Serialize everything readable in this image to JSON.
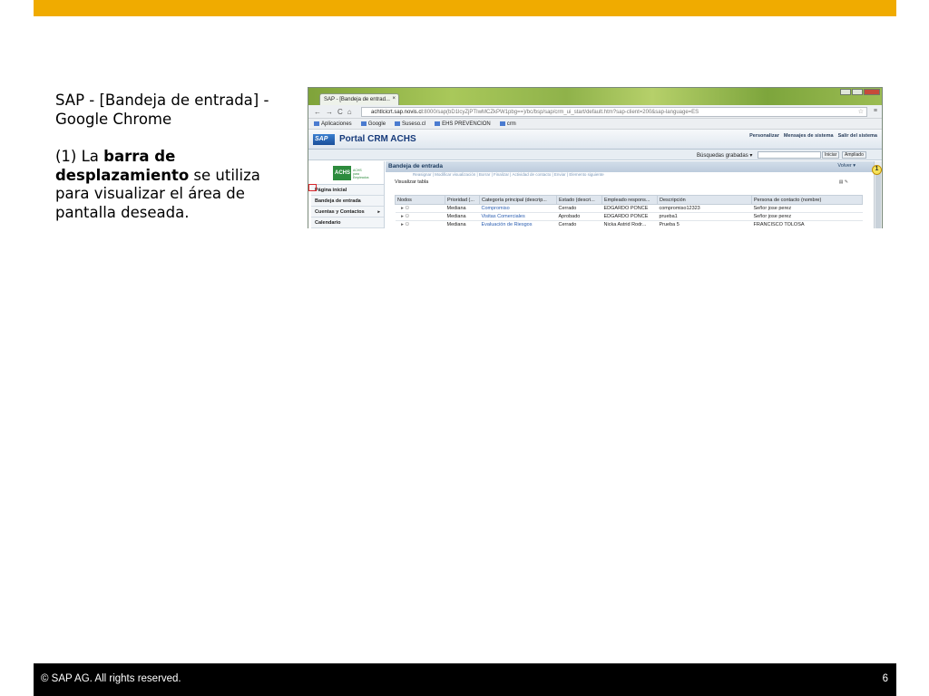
{
  "slide": {
    "title": "SAP - [Bandeja de entrada] - Google Chrome",
    "para_prefix": "(1) La ",
    "para_bold": "barra de desplazamiento",
    "para_suffix": " se utiliza para visualizar el área de pantalla deseada.",
    "footer_copyright": "©  SAP AG. All rights reserved.",
    "page_number": "6",
    "colors": {
      "accent_bar": "#f0ab00",
      "footer_bg": "#000000"
    }
  },
  "browser": {
    "tab_title": "SAP - [Bandeja de entrad...",
    "tab_close": "×",
    "url_host": "achtlcicrt.sap.novis.cl",
    "url_path": ":8000/sap(bD1lcyZjPTIwMCZkPW1pbg==)/bc/bsp/sap/crm_ui_start/default.htm?sap-client=200&sap-language=ES",
    "bookmarks": [
      "Aplicaciones",
      "Google",
      "Suseso.cl",
      "EHS PREVENCION",
      "crm"
    ]
  },
  "portal": {
    "logo_text": "SAP",
    "title": "Portal CRM ACHS",
    "header_links": [
      "Personalizar",
      "Mensajes de sistema",
      "Salir del sistema"
    ],
    "saved_searches": "Búsquedas grabadas ▾",
    "search_button": "Iniciar",
    "advanced_button": "Ampliado"
  },
  "sidebar": {
    "logo": "ACHS",
    "logo_sub": "ACHS para Empleados",
    "items": [
      {
        "label": "Página inicial",
        "arrow": ""
      },
      {
        "label": "Bandeja de entrada",
        "arrow": ""
      },
      {
        "label": "Cuentas y Contactos",
        "arrow": "►"
      },
      {
        "label": "Calendario",
        "arrow": ""
      }
    ]
  },
  "inbox": {
    "header": "Bandeja de entrada",
    "back": "Volver ▾",
    "cut_links": "Reasignar  |  Modificar visualización  |  Borrar  |  Finalizar  |  Actividad de contacto  |  Enviar  |  Elemento siguiente",
    "table_action": "Visualizar tabla",
    "columns": [
      "Nodos",
      "Prioridad (...",
      "Categoría principal (descrip...",
      "Estado (descri...",
      "Empleado respons...",
      "Descripción",
      "Persona de contacto (nombre)"
    ],
    "rows": [
      [
        "Mediana",
        "Compromiso",
        "Cerrado",
        "EDGARDO PONCE",
        "compromiso12323",
        "Señor jose perez"
      ],
      [
        "Mediana",
        "Visitas Comerciales",
        "Aprobado",
        "EDGARDO PONCE",
        "prueba1",
        "Señor jose perez"
      ],
      [
        "Mediana",
        "Evaluación de Riesgos",
        "Cerrado",
        "Nicka Astrid Rodr...",
        "Prueba 5",
        "FRANCISCO TOLOSA"
      ]
    ]
  },
  "annotation": {
    "callout_number": "1"
  }
}
